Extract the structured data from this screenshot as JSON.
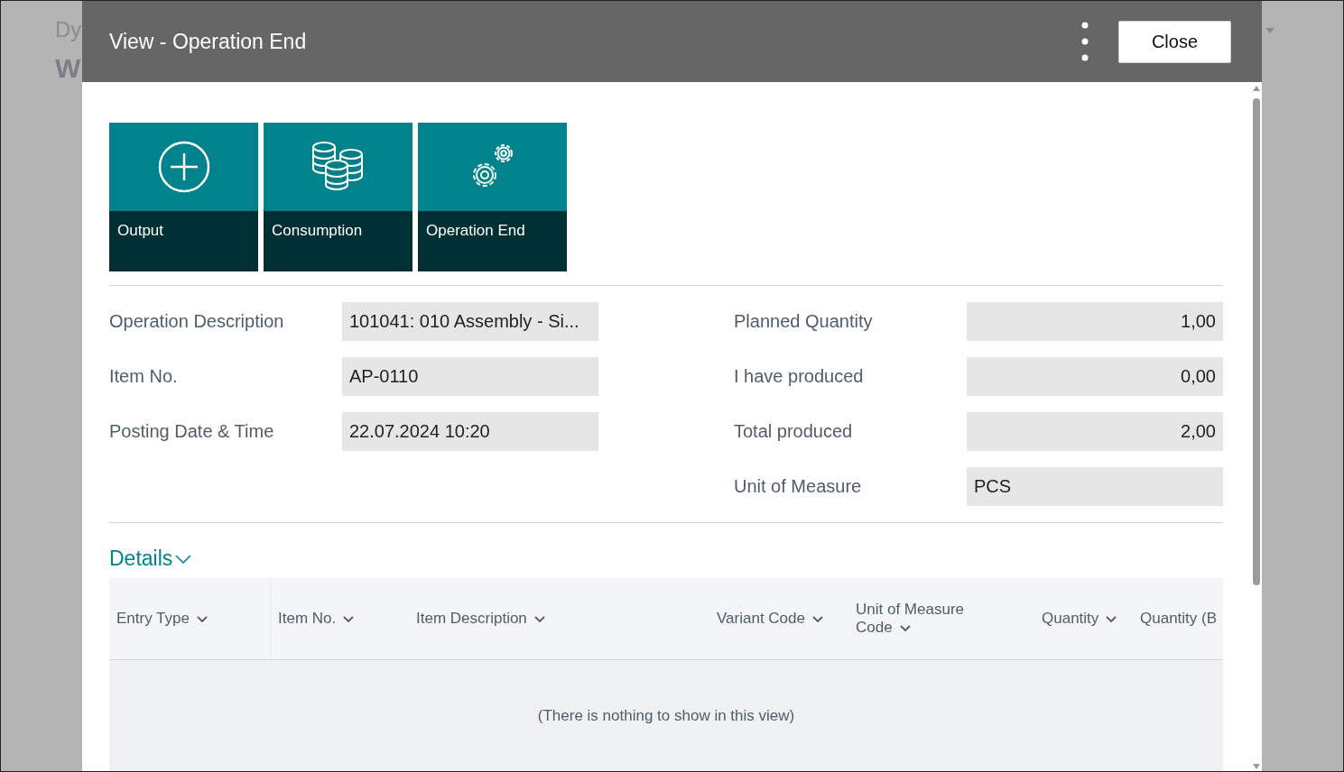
{
  "background_page": {
    "title": "Dy",
    "subtitle": "W"
  },
  "window": {
    "title": "View - Operation End",
    "close_button": "Close"
  },
  "actions": [
    {
      "label": "Output",
      "kind": "plus"
    },
    {
      "label": "Consumption",
      "kind": "coins"
    },
    {
      "label": "Operation End",
      "kind": "gears"
    }
  ],
  "fields_left": [
    {
      "label": "Operation Description",
      "value": "101041: 010 Assembly - Si..."
    },
    {
      "label": "Item No.",
      "value": "AP-0110"
    },
    {
      "label": "Posting Date & Time",
      "value": "22.07.2024 10:20"
    }
  ],
  "fields_right": [
    {
      "label": "Planned Quantity",
      "value": "1,00",
      "kind": "number"
    },
    {
      "label": "I have produced",
      "value": "0,00",
      "kind": "number"
    },
    {
      "label": "Total produced",
      "value": "2,00",
      "kind": "number"
    },
    {
      "label": "Unit of Measure",
      "value": "PCS",
      "kind": "text"
    }
  ],
  "details": {
    "title": "Details",
    "expanded": true,
    "columns": [
      {
        "label": "Entry Type",
        "sortable": true
      },
      {
        "label": "Item No.",
        "sortable": true
      },
      {
        "label": "Item Description",
        "sortable": true
      },
      {
        "label": "Variant Code",
        "sortable": true
      },
      {
        "label": "Unit of Measure Code",
        "sortable": true
      },
      {
        "label": "Quantity",
        "sortable": true
      },
      {
        "label": "Quantity (B",
        "sortable": false
      }
    ],
    "empty_message": "(There is nothing to show in this view)"
  }
}
